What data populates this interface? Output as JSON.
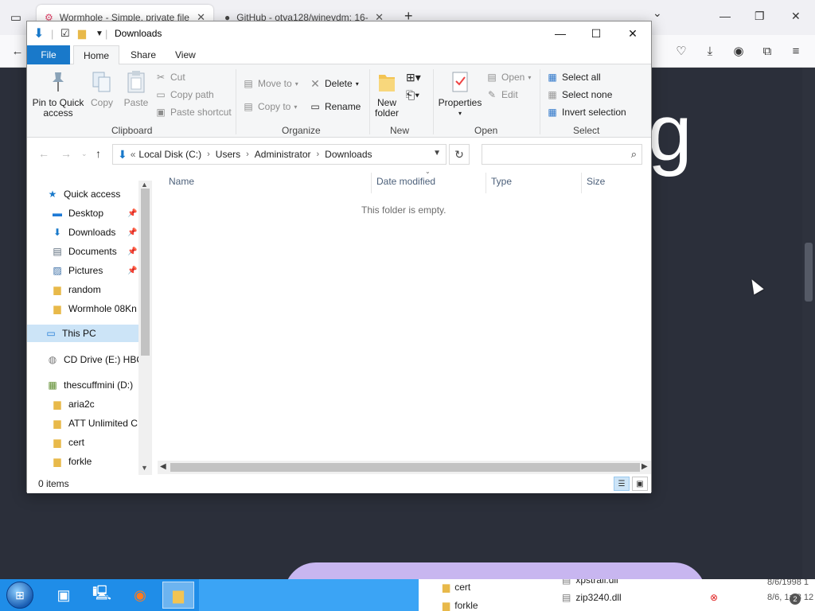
{
  "browser": {
    "tabs": [
      {
        "title": "Wormhole - Simple, private file",
        "active": true
      },
      {
        "title": "GitHub - otya128/winevdm: 16-",
        "active": false
      }
    ],
    "new_tab_label": "+",
    "tab_list_label": "⌄",
    "window_controls": {
      "minimize": "—",
      "restore": "❐",
      "close": "✕"
    }
  },
  "page": {
    "hero_letter": "g",
    "accent_color": "#c8b6f0",
    "background_color": "#2b2f3a"
  },
  "explorer": {
    "title": "Downloads",
    "ribbon_tabs": [
      "File",
      "Home",
      "Share",
      "View"
    ],
    "help_label": "?",
    "clipboard": {
      "pin_label": "Pin to Quick access",
      "copy_label": "Copy",
      "paste_label": "Paste",
      "cut_label": "Cut",
      "copy_path_label": "Copy path",
      "paste_shortcut_label": "Paste shortcut",
      "group_label": "Clipboard"
    },
    "organize": {
      "move_to_label": "Move to",
      "copy_to_label": "Copy to",
      "delete_label": "Delete",
      "rename_label": "Rename",
      "group_label": "Organize"
    },
    "new_group": {
      "new_folder_label": "New folder",
      "group_label": "New"
    },
    "open_group": {
      "properties_label": "Properties",
      "open_label": "Open",
      "edit_label": "Edit",
      "group_label": "Open"
    },
    "select_group": {
      "select_all_label": "Select all",
      "select_none_label": "Select none",
      "invert_selection_label": "Invert selection",
      "group_label": "Select"
    },
    "address": {
      "prefix": "«",
      "crumbs": [
        "Local Disk (C:)",
        "Users",
        "Administrator",
        "Downloads"
      ],
      "search_placeholder": ""
    },
    "nav": {
      "quick_access": "Quick access",
      "pinned": [
        "Desktop",
        "Downloads",
        "Documents",
        "Pictures"
      ],
      "recent": [
        "random",
        "Wormhole 08Kn"
      ],
      "this_pc": "This PC",
      "cd_drive": "CD Drive (E:) HBC",
      "d_drive": "thescuffmini (D:)",
      "d_children": [
        "aria2c",
        "ATT Unlimited C",
        "cert",
        "forkle"
      ]
    },
    "columns": [
      "Name",
      "Date modified",
      "Type",
      "Size"
    ],
    "empty_message": "This folder is empty.",
    "status": "0 items"
  },
  "taskbar": {
    "tray_files": [
      "cert",
      "forkle"
    ],
    "tray_dlls": [
      "xpstrall.dll",
      "zip3240.dll"
    ],
    "tray_times": [
      "8/6/1998 1",
      "8/6, 1:28 12"
    ],
    "badge_count": "2"
  }
}
